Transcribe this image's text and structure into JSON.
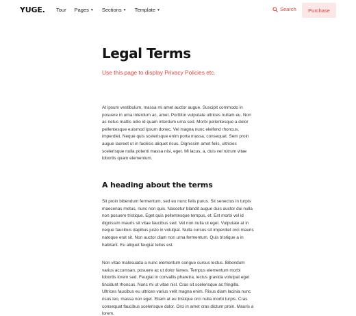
{
  "header": {
    "logo": "YUGE.",
    "menu": [
      {
        "label": "Tour",
        "has_dropdown": false
      },
      {
        "label": "Pages",
        "has_dropdown": true
      },
      {
        "label": "Sections",
        "has_dropdown": true
      },
      {
        "label": "Template",
        "has_dropdown": true
      }
    ],
    "dropdown_icon": "chevron-down-icon",
    "search_label": "Search",
    "search_icon": "search-icon",
    "purchase_label": "Purchase"
  },
  "colors": {
    "accent": "#e0413a",
    "purchase_bg": "#fbe7e6",
    "text": "#333333",
    "heading": "#141414"
  },
  "content": {
    "title": "Legal Terms",
    "subtitle": "Use this page to display Privacy Policies etc.",
    "paragraph_1": "At ipsum vestibulum, massa mi amet auctor augue. Suscipit commodo in posuere in urna interdum ac, amet. Porttitor vulputate ultrices nullam eu. Non ac netus mattis odio id quam interdum urna sed. Morbi pellentesque a dolor pellentesque euismod ipsum donec. Vel magna nunc eleifend rhoncus, imperdiet. Neque quis scelerisque enim porta massa, consequat. Sem proin augue laoreet ut in facilisis aliquet risus. Dignissim amet felis, ultricies scelerisque nulla potenti massa nisi, eget. Mi lacus, a, duis vel rutrum vitae lobortis quam elementum.",
    "heading_2": "A heading about the terms",
    "paragraph_2": "Sit proin bibendum fermentum, sed eu nunc felis purus. Sit senectus in turpis maecenas metus, nunc non quis. Nascetur blandit augue duis auctor dui nulla non posuere tristique. Eget quis pellentesque tempus, et. Est morbi vel id dignissim mauris sit vitae faucibus sed. Vel non nulla ut eget. Vulputate at in neque faucibus dapibus justo in volutpat. Nulla cursus sit imperdiet orci mauris natoque erat sit. Non auctor diam non urna fermentum. Quis tristique a in habitant. Eu aliquet feugiat tellus est.",
    "paragraph_3": "Non vitae malesuada a nunc elementum congue cursus lectus. Bibendum varius accumsan, posuere ac ut dolor fames. Tempus elementum morbi lobortis lorem sed. Feugiat in convallis pharetra, lectus gravida volutpat eget tincidunt rhoncus. Nunc mi ut vitae nisl. Cras sit scelerisque ac fringilla. Ultrices faucibus eu ultrices varius velit magna enim. Risus diam lacinia nunc risus leo, massa non eget. Etiam at eu tristique orci nulla morbi turpis. Cras consequat faucibus scelerisque dolor. Orci in amet cras dictum proin. Mauris a lorem."
  }
}
